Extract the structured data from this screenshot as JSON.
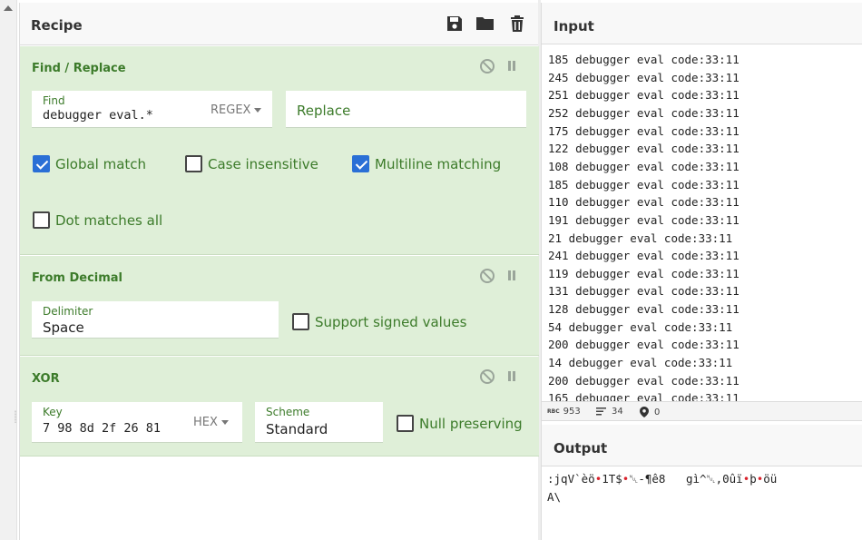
{
  "recipe": {
    "title": "Recipe",
    "operations": [
      {
        "name": "Find / Replace",
        "find_label": "Find",
        "find_value": "debugger eval.*",
        "find_mode": "REGEX",
        "replace_placeholder": "Replace",
        "options": [
          {
            "label": "Global match",
            "checked": true
          },
          {
            "label": "Case insensitive",
            "checked": false
          },
          {
            "label": "Multiline matching",
            "checked": true
          },
          {
            "label": "Dot matches all",
            "checked": false
          }
        ]
      },
      {
        "name": "From Decimal",
        "delimiter_label": "Delimiter",
        "delimiter_value": "Space",
        "signed_label": "Support signed values",
        "signed_checked": false
      },
      {
        "name": "XOR",
        "key_label": "Key",
        "key_value": "7 98 8d 2f 26 81",
        "key_format": "HEX",
        "scheme_label": "Scheme",
        "scheme_value": "Standard",
        "null_label": "Null preserving",
        "null_checked": false
      }
    ]
  },
  "input": {
    "title": "Input",
    "lines": [
      "185 debugger eval code:33:11",
      "245 debugger eval code:33:11",
      "251 debugger eval code:33:11",
      "252 debugger eval code:33:11",
      "175 debugger eval code:33:11",
      "122 debugger eval code:33:11",
      "108 debugger eval code:33:11",
      "185 debugger eval code:33:11",
      "110 debugger eval code:33:11",
      "191 debugger eval code:33:11",
      "21 debugger eval code:33:11",
      "241 debugger eval code:33:11",
      "119 debugger eval code:33:11",
      "131 debugger eval code:33:11",
      "128 debugger eval code:33:11",
      "54 debugger eval code:33:11",
      "200 debugger eval code:33:11",
      "14 debugger eval code:33:11",
      "200 debugger eval code:33:11",
      "165 debugger eval code:33:11"
    ],
    "stats": {
      "char_icon": "RBC",
      "length": "953",
      "lines_count": "34",
      "position": "0"
    }
  },
  "output": {
    "title": "Output",
    "line1_parts": [
      ":jqV`èö",
      "•",
      "1T$",
      "•",
      "␀-¶ê8   gì^␀,0ûï",
      "•",
      "þ",
      "•",
      "öü"
    ],
    "line2": "A\\"
  },
  "colors": {
    "op_background": "#dfefd8",
    "op_title": "#3c7b2a",
    "checkbox_on": "#2a6fd6"
  }
}
